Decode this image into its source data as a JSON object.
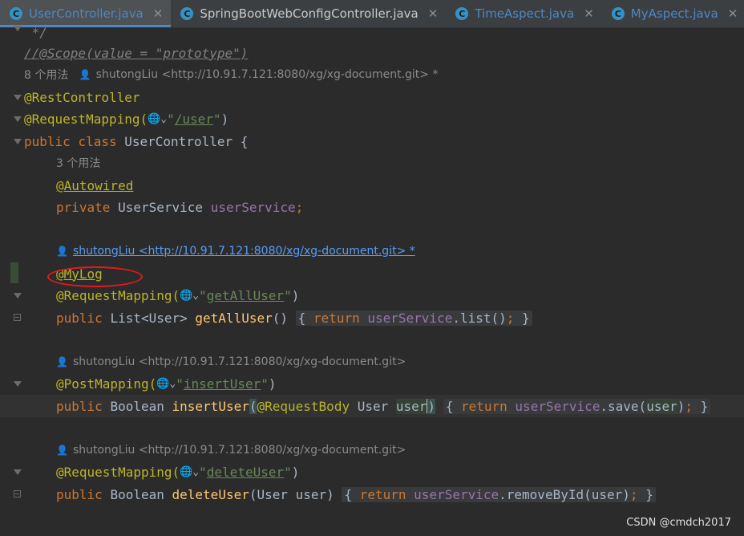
{
  "tabs": [
    {
      "label": "UserController.java",
      "icon": "class-icon"
    },
    {
      "label": "SpringBootWebConfigController.java",
      "icon": "class-icon"
    },
    {
      "label": "TimeAspect.java",
      "icon": "class-icon"
    },
    {
      "label": "MyAspect.java",
      "icon": "class-icon"
    },
    {
      "label": "@",
      "icon": "annotation-icon"
    }
  ],
  "tab_close_glyph": "✕",
  "tab_icon_letter": "C",
  "code": {
    "comment_end": " */",
    "scope_comment": "//@Scope(value = \"prototype\")",
    "class_usages": "8 个用法",
    "class_author": "shutongLiu <http://10.91.7.121:8080/xg/xg-document.git> *",
    "rest_controller": "@RestController",
    "request_mapping": "@RequestMapping(",
    "request_mapping_path": "/user",
    "quote": "\"",
    "close_paren": ")",
    "public": "public",
    "class_kw": "class",
    "class_name": "UserController",
    "open_brace": "{",
    "field_usages": "3 个用法",
    "autowired": "@Autowired",
    "private": "private",
    "service_type": "UserService",
    "service_field": "userService",
    "semicolon": ";",
    "m1_author": "shutongLiu <http://10.91.7.121:8080/xg/xg-document.git> *",
    "mylog": "@MyLog",
    "m1_mapping": "@RequestMapping(",
    "m1_path": "getAllUser",
    "list_type": "List<User>",
    "m1_name": "getAllUser",
    "m1_params": "()",
    "return_kw": "return",
    "m1_call": ".list()",
    "close_brace": "}",
    "m2_author": "shutongLiu <http://10.91.7.121:8080/xg/xg-document.git>",
    "post_mapping": "@PostMapping(",
    "m2_path": "insertUser",
    "boolean_type": "Boolean",
    "m2_name": "insertUser",
    "open_paren": "(",
    "request_body": "@RequestBody",
    "user_type": "User",
    "user_param": "user",
    "m2_call": ".save(",
    "user_arg": "user",
    "m3_author": "shutongLiu <http://10.91.7.121:8080/xg/xg-document.git>",
    "m3_mapping": "@RequestMapping(",
    "m3_path": "deleteUser",
    "m3_name": "deleteUser",
    "m3_params": "(User user)",
    "m3_call": ".removeById(",
    "globe": "🌐⌄"
  },
  "watermark": "CSDN @cmdch2017",
  "colors": {
    "keyword": "#cc7832",
    "annotation": "#bbb529",
    "string": "#6a8759",
    "method": "#ffc66d",
    "field": "#9876aa",
    "highlight_circle": "#e8181e"
  }
}
